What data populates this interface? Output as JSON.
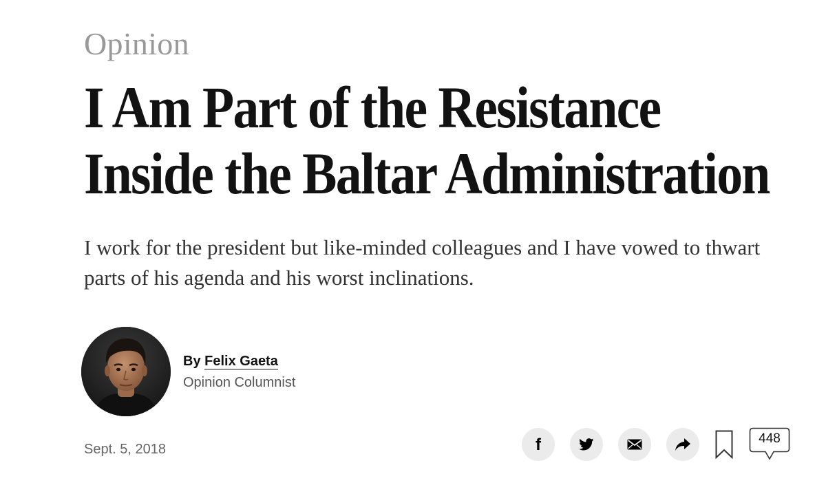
{
  "article": {
    "section": "Opinion",
    "headline_lines": [
      "I Am Part of the Resistance",
      "Inside the Baltar Administration"
    ],
    "summary": "I work for the president but like-minded colleagues and I have vowed to thwart parts of his agenda and his worst inclinations.",
    "byline_prefix": "By ",
    "author_name": "Felix Gaeta",
    "author_role": "Opinion Columnist",
    "date": "Sept. 5, 2018"
  },
  "share_tools": {
    "facebook_icon": "facebook-icon",
    "twitter_icon": "twitter-icon",
    "email_icon": "email-icon",
    "share_icon": "share-arrow-icon",
    "save_icon": "bookmark-icon",
    "comments_icon": "comment-bubble-icon",
    "comments_count": "448"
  },
  "colors": {
    "section_label": "#999999",
    "headline": "#121212",
    "summary": "#333333",
    "secondary_text": "#666666",
    "icon_background": "#ebebeb"
  }
}
